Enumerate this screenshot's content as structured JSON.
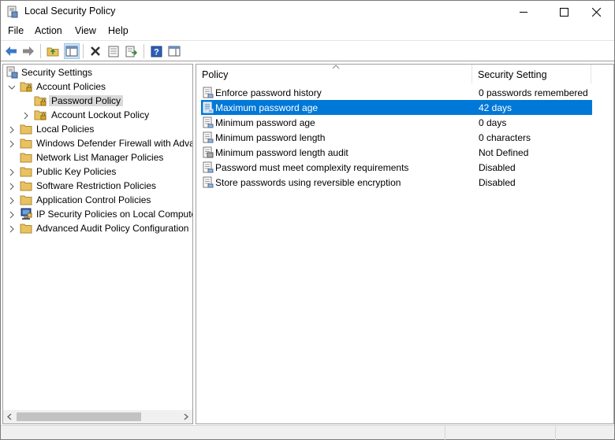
{
  "window": {
    "title": "Local Security Policy",
    "icon": "security-policy-app-icon",
    "controls": {
      "minimize": "minimize-icon",
      "maximize": "maximize-icon",
      "close": "close-icon"
    }
  },
  "menu": {
    "file": "File",
    "action": "Action",
    "view": "View",
    "help": "Help"
  },
  "toolbar": {
    "buttons": [
      "back-icon",
      "forward-icon",
      "up-folder-icon",
      "show-hide-console-tree-icon",
      "delete-icon",
      "properties-icon",
      "export-list-icon",
      "help-icon",
      "show-action-pane-icon"
    ]
  },
  "tree": {
    "root": "Security Settings",
    "account_policies": "Account Policies",
    "password_policy": "Password Policy",
    "account_lockout_policy": "Account Lockout Policy",
    "local_policies": "Local Policies",
    "firewall": "Windows Defender Firewall with Adva",
    "network_list": "Network List Manager Policies",
    "public_key": "Public Key Policies",
    "software_restriction": "Software Restriction Policies",
    "application_control": "Application Control Policies",
    "ip_security": "IP Security Policies on Local Compute",
    "advanced_audit": "Advanced Audit Policy Configuration"
  },
  "list": {
    "columns": {
      "policy": "Policy",
      "setting": "Security Setting"
    },
    "rows": [
      {
        "policy": "Enforce password history",
        "setting": "0 passwords remembered"
      },
      {
        "policy": "Maximum password age",
        "setting": "42 days",
        "selected": true
      },
      {
        "policy": "Minimum password age",
        "setting": "0 days"
      },
      {
        "policy": "Minimum password length",
        "setting": "0 characters"
      },
      {
        "policy": "Minimum password length audit",
        "setting": "Not Defined"
      },
      {
        "policy": "Password must meet complexity requirements",
        "setting": "Disabled"
      },
      {
        "policy": "Store passwords using reversible encryption",
        "setting": "Disabled"
      }
    ]
  },
  "colors": {
    "selection": "#0078d7",
    "tree_selection": "#d9d9d9",
    "folder": "#e8c260"
  }
}
